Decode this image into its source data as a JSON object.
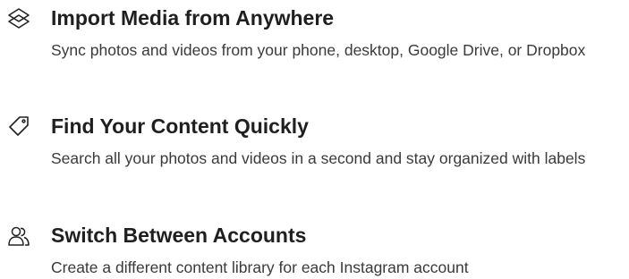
{
  "features": [
    {
      "icon": "layers-icon",
      "title": "Import Media from Anywhere",
      "description": "Sync photos and videos from your phone, desktop, Google Drive, or Dropbox"
    },
    {
      "icon": "tag-icon",
      "title": "Find Your Content Quickly",
      "description": "Search all your photos and videos in a second and stay organized with labels"
    },
    {
      "icon": "users-icon",
      "title": "Switch Between Accounts",
      "description": "Create a different content library for each Instagram account"
    }
  ],
  "colors": {
    "text": "#1f1f1f",
    "description": "#3a3a3a",
    "background": "#ffffff"
  }
}
